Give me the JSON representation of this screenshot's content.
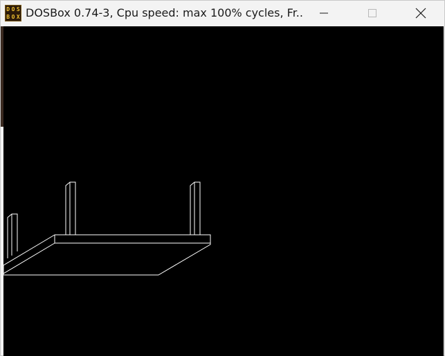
{
  "window": {
    "title": "DOSBox 0.74-3, Cpu speed: max 100% cycles, Fr...",
    "app_icon": {
      "name": "dosbox-icon",
      "letters": [
        "D",
        "O",
        "S",
        "B",
        "O",
        "X"
      ]
    },
    "controls": {
      "minimize_icon": "minimize-icon",
      "maximize_icon": "maximize-icon",
      "close_icon": "close-icon"
    }
  },
  "screen": {
    "background": "#000000",
    "line_color": "#ffffff",
    "scene": "wireframe-table"
  }
}
